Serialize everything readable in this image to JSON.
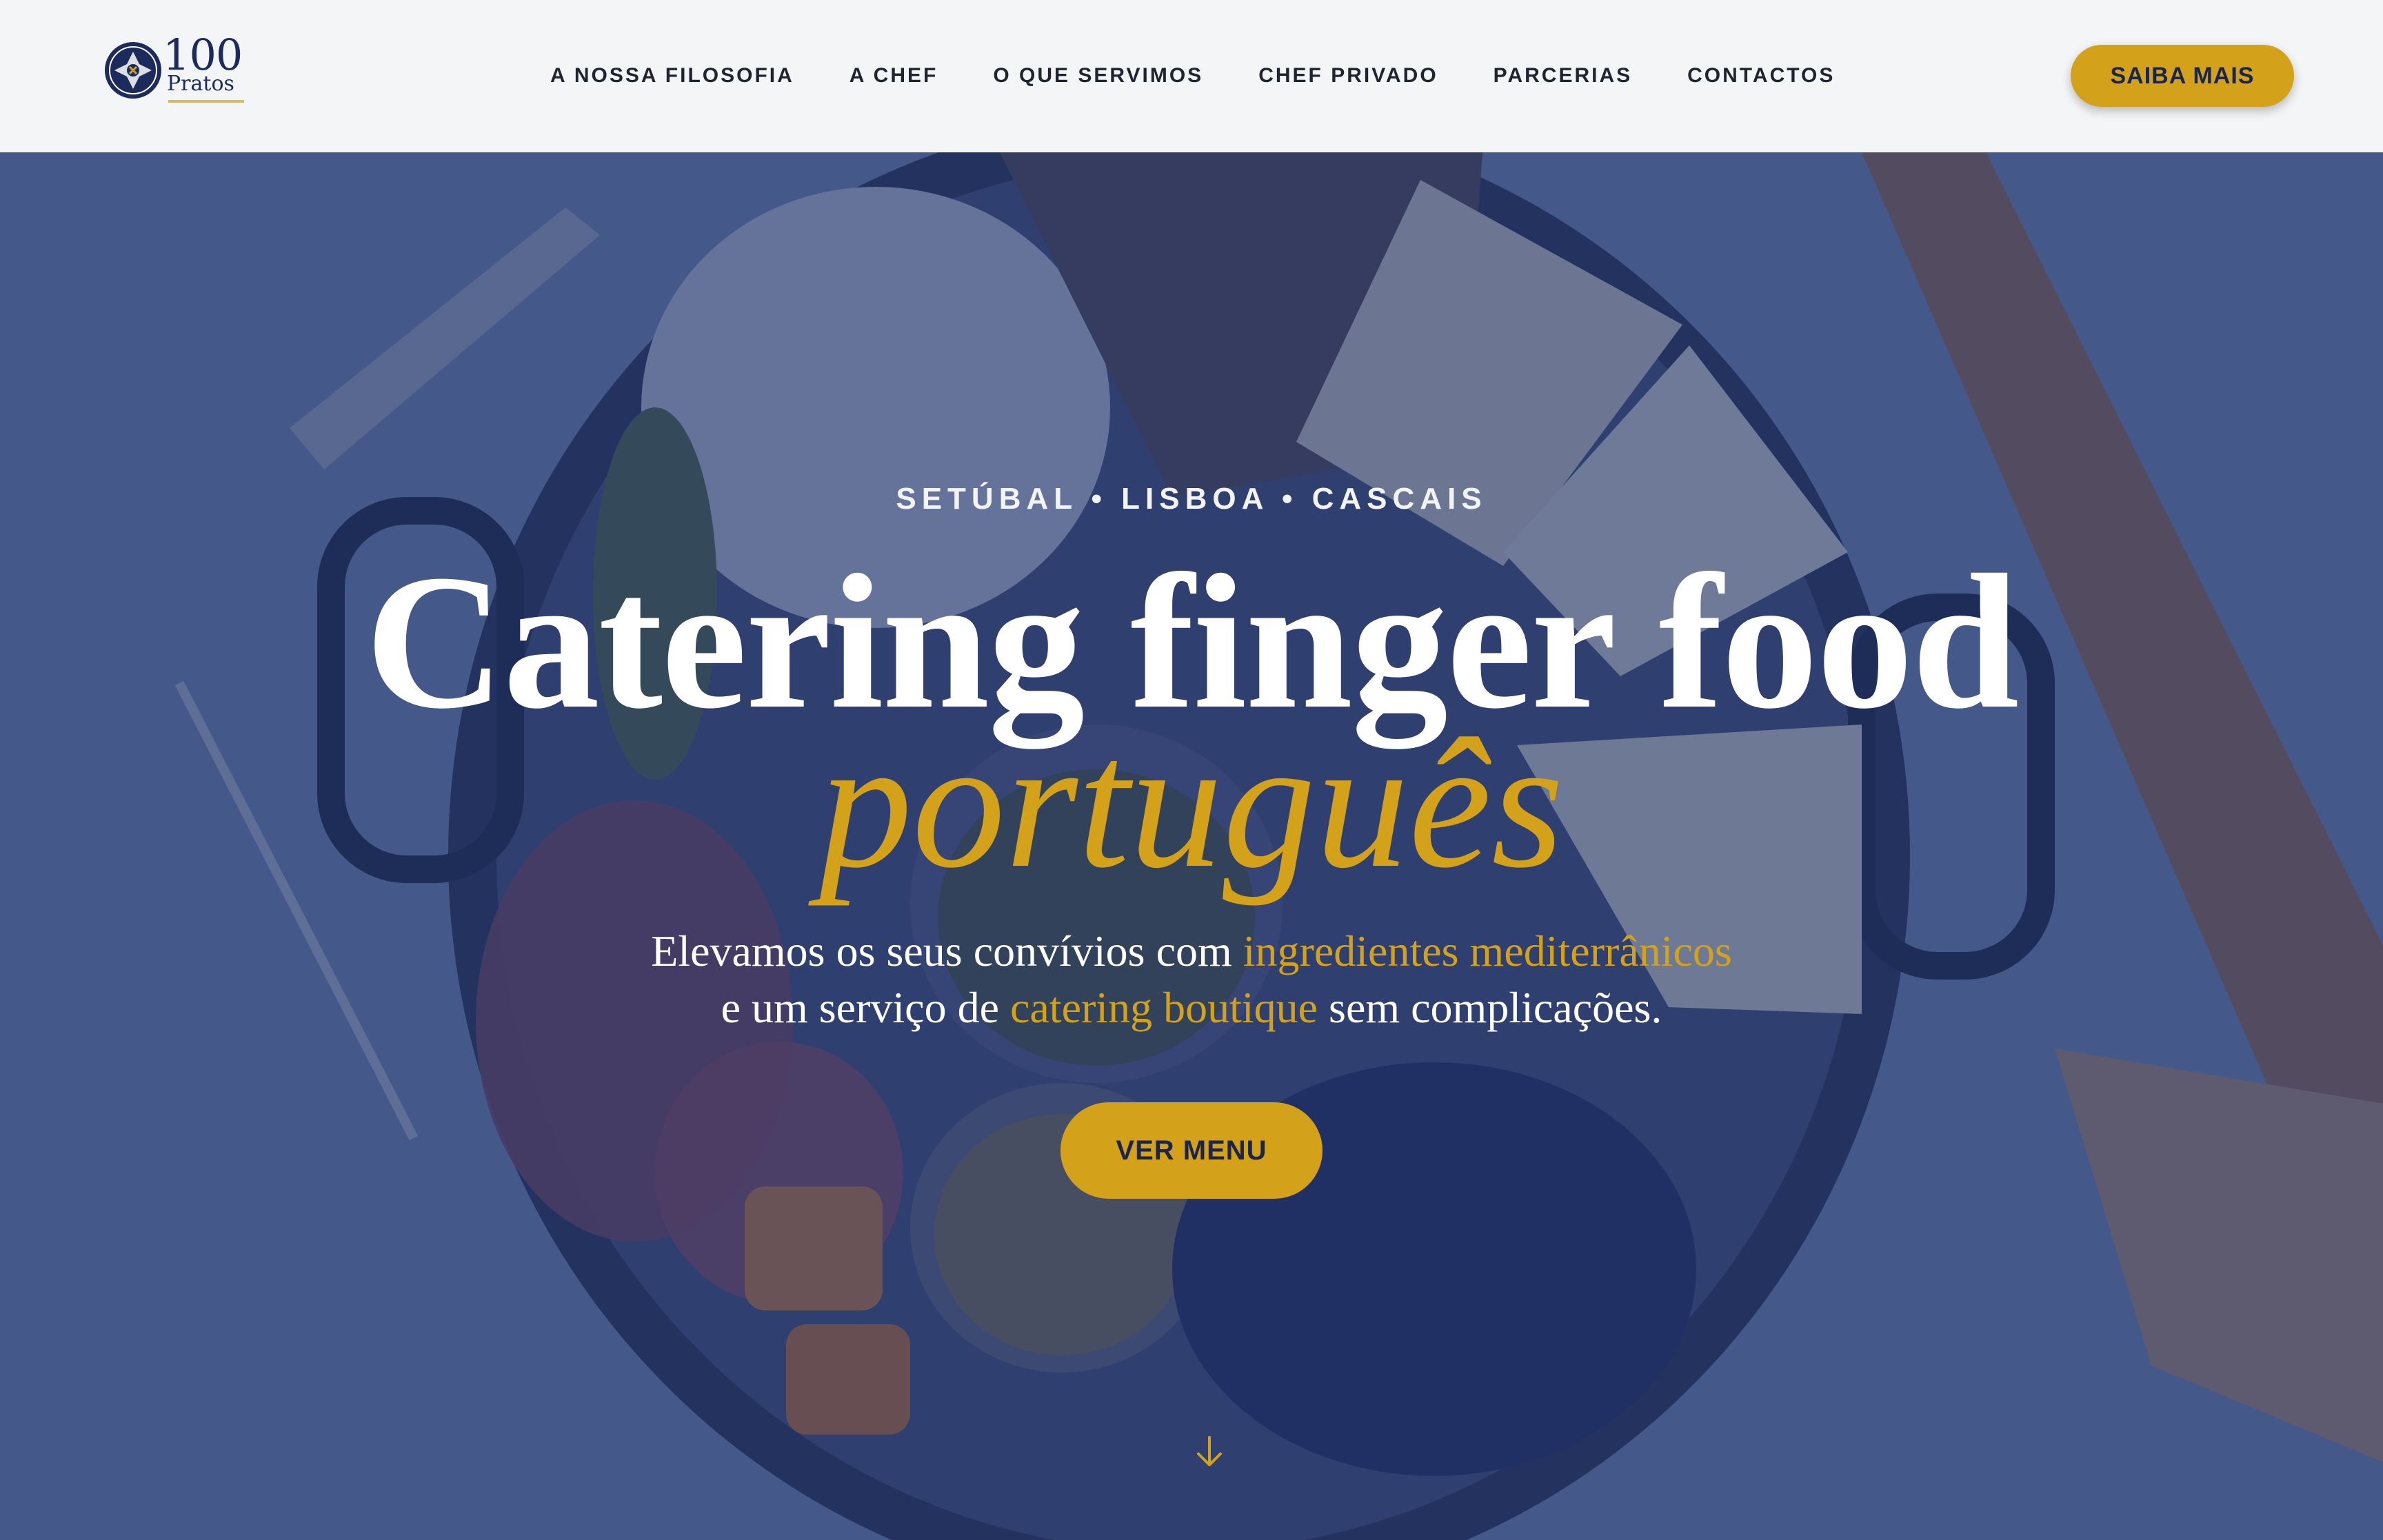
{
  "header": {
    "logo": {
      "number": "100",
      "word": "Pratos"
    },
    "nav": [
      "A NOSSA FILOSOFIA",
      "A CHEF",
      "O QUE SERVIMOS",
      "CHEF PRIVADO",
      "PARCERIAS",
      "CONTACTOS"
    ],
    "cta_label": "SAIBA MAIS"
  },
  "hero": {
    "eyebrow": "SETÚBAL • LISBOA • CASCAIS",
    "headline": "Catering finger food",
    "headline_accent": "português",
    "subtitle": {
      "line1_a": "Elevamos os seus convívios com ",
      "line1_highlight": "ingredientes mediterrânicos",
      "line2_a": "e um serviço de ",
      "line2_highlight": "catering boutique",
      "line2_b": " sem complicações."
    },
    "cta_label": "VER MENU",
    "scroll_icon": "arrow-down-icon"
  },
  "colors": {
    "accent": "#d4a21a",
    "navy": "#1d2b5c",
    "overlay": "#1e3470",
    "header_bg": "#f4f5f7"
  }
}
